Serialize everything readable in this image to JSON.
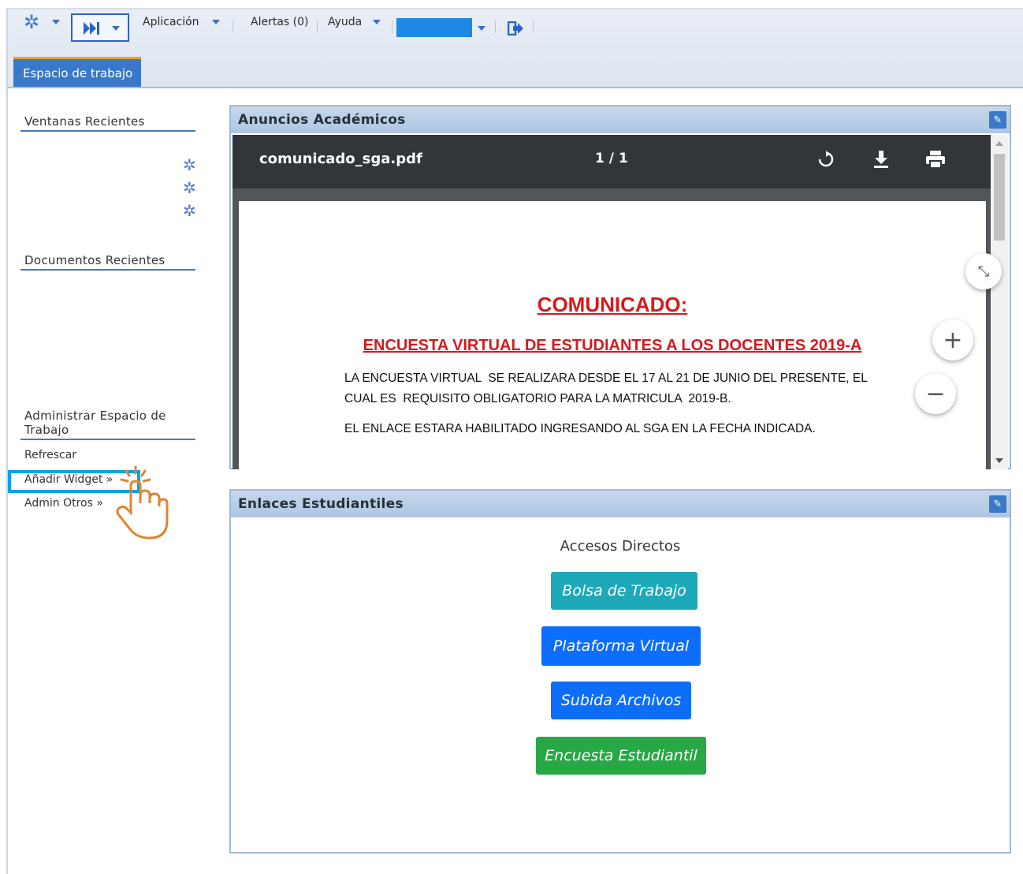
{
  "toolbar": {
    "aplicacion": "Aplicación",
    "alertas": "Alertas (0)",
    "ayuda": "Ayuda",
    "tab_workspace": "Espacio de trabajo"
  },
  "sidebar": {
    "ventanas_title": "Ventanas Recientes",
    "documentos_title": "Documentos Recientes",
    "admin_title": "Administrar Espacio de Trabajo",
    "links": [
      "Refrescar",
      "Añadir Widget »",
      "Admin Otros »"
    ]
  },
  "anuncios": {
    "title": "Anuncios Académicos",
    "pdf_name": "comunicado_sga.pdf",
    "pdf_pages": "1 / 1",
    "heading": "COMUNICADO:",
    "subheading": "ENCUESTA VIRTUAL DE ESTUDIANTES A LOS DOCENTES 2019-A",
    "line1": "LA ENCUESTA VIRTUAL  SE REALIZARA DESDE EL 17 AL 21 DE JUNIO DEL PRESENTE, EL",
    "line2": "CUAL ES  REQUISITO OBLIGATORIO PARA LA MATRICULA  2019-B.",
    "line3": "EL ENLACE ESTARA HABILITADO INGRESANDO AL SGA EN LA FECHA INDICADA."
  },
  "enlaces": {
    "title": "Enlaces Estudiantiles",
    "accesos": "Accesos Directos",
    "buttons": [
      "Bolsa de Trabajo",
      "Plataforma Virtual",
      "Subida Archivos",
      "Encuesta Estudiantil"
    ]
  },
  "colors": {
    "accent": "#3a78c9",
    "highlight": "#00a2e8",
    "btn_teal": "#1ea9b8",
    "btn_blue": "#0d6efd",
    "btn_green": "#28a745",
    "pdf_red": "#d7191c"
  }
}
